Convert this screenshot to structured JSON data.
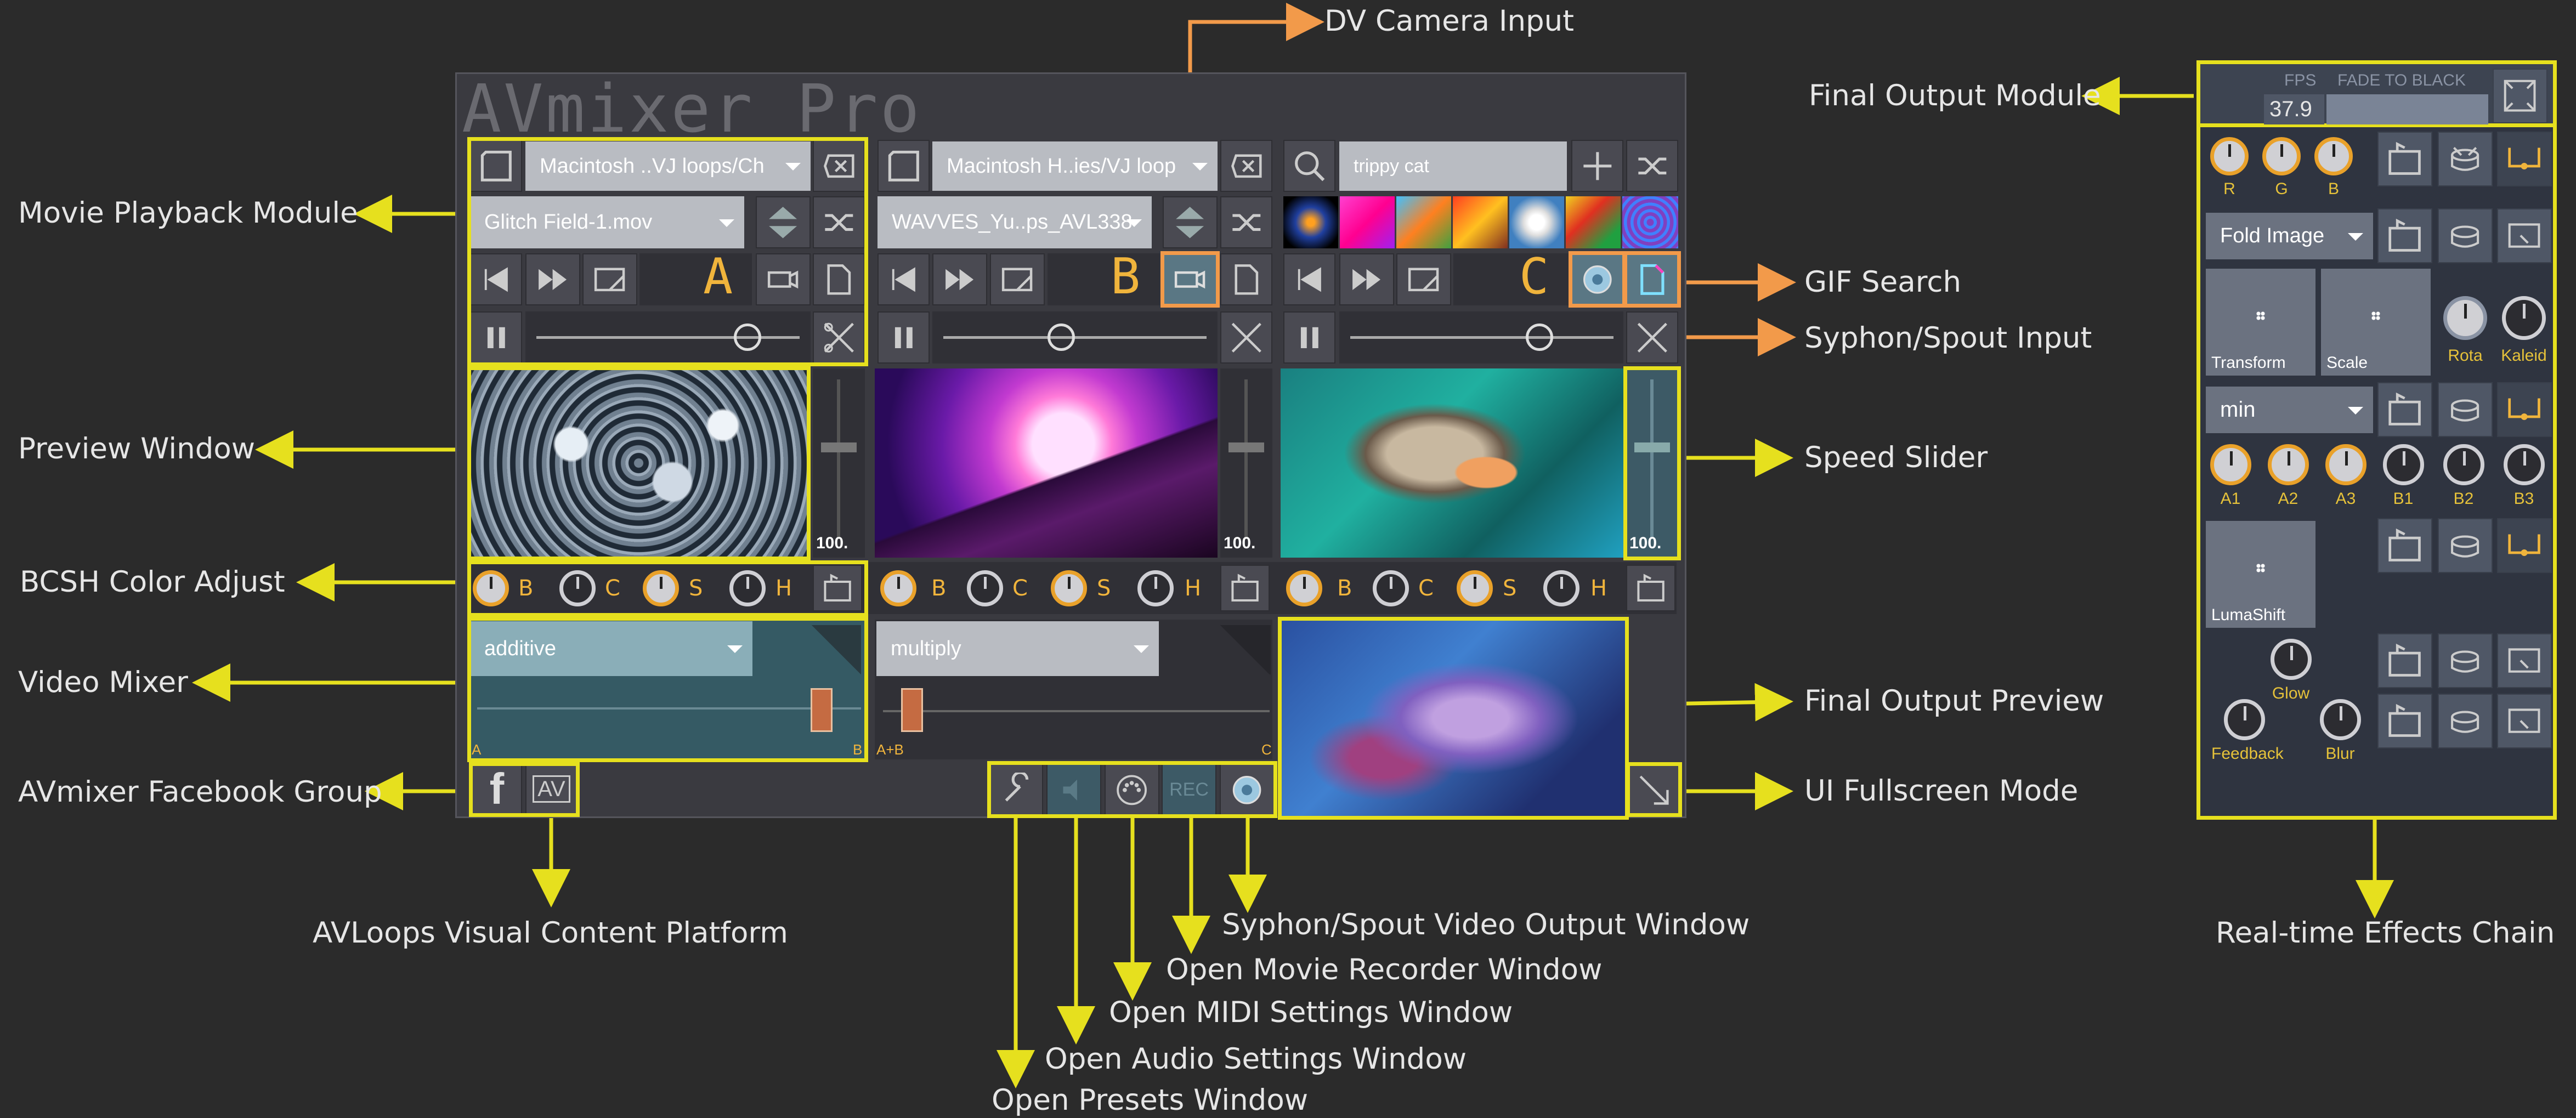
{
  "app_title": "AVmixer Pro",
  "annotations": {
    "dv_camera": "DV Camera Input",
    "final_output_module": "Final Output Module",
    "movie_playback": "Movie Playback Module",
    "gif_search": "GIF Search",
    "syphon_input": "Syphon/Spout Input",
    "preview_window": "Preview Window",
    "speed_slider": "Speed Slider",
    "bcsh": "BCSH Color Adjust",
    "video_mixer": "Video Mixer",
    "final_output_preview": "Final Output Preview",
    "facebook": "AVmixer Facebook Group",
    "fullscreen": "UI Fullscreen Mode",
    "avloops": "AVLoops Visual Content Platform",
    "syphon_output": "Syphon/Spout Video Output Window",
    "movie_recorder": "Open Movie Recorder Window",
    "midi": "Open MIDI Settings Window",
    "audio": "Open Audio Settings Window",
    "presets": "Open Presets Window",
    "effects_chain": "Real-time Effects Chain"
  },
  "decks": [
    {
      "folder": "Macintosh ..VJ loops/Ch",
      "file": "Glitch Field-1.mov",
      "letter": "A",
      "speed": "100."
    },
    {
      "folder": "Macintosh H..ies/VJ loop",
      "file": "WAVVES_Yu..ps_AVL338",
      "letter": "B",
      "speed": "100."
    },
    {
      "search": "trippy cat",
      "letter": "C",
      "speed": "100."
    }
  ],
  "bcsh_labels": [
    "B",
    "C",
    "S",
    "H"
  ],
  "mixers": [
    {
      "mode": "additive",
      "left": "A",
      "right": "B"
    },
    {
      "mode": "multiply",
      "left": "A+B",
      "right": "C"
    }
  ],
  "bottom_buttons": {
    "rec": "REC",
    "facebook": "f",
    "avloops": "AV"
  },
  "output": {
    "fps_label": "FPS",
    "fade_label": "FADE TO BLACK",
    "fps_value": "37.9"
  },
  "effects": {
    "rgb_labels": [
      "R",
      "G",
      "B"
    ],
    "effect1": "Fold Image",
    "slot_transform": "Transform",
    "slot_scale": "Scale",
    "rota": "Rota",
    "kaleid": "Kaleid",
    "effect2": "min",
    "a_labels": [
      "A1",
      "A2",
      "A3"
    ],
    "b_labels": [
      "B1",
      "B2",
      "B3"
    ],
    "lumashift": "LumaShift",
    "glow": "Glow",
    "feedback": "Feedback",
    "blur": "Blur"
  },
  "colors": {
    "yellow": "#e6e01e",
    "orange": "#f29a4a",
    "accent": "#f0b43c"
  }
}
